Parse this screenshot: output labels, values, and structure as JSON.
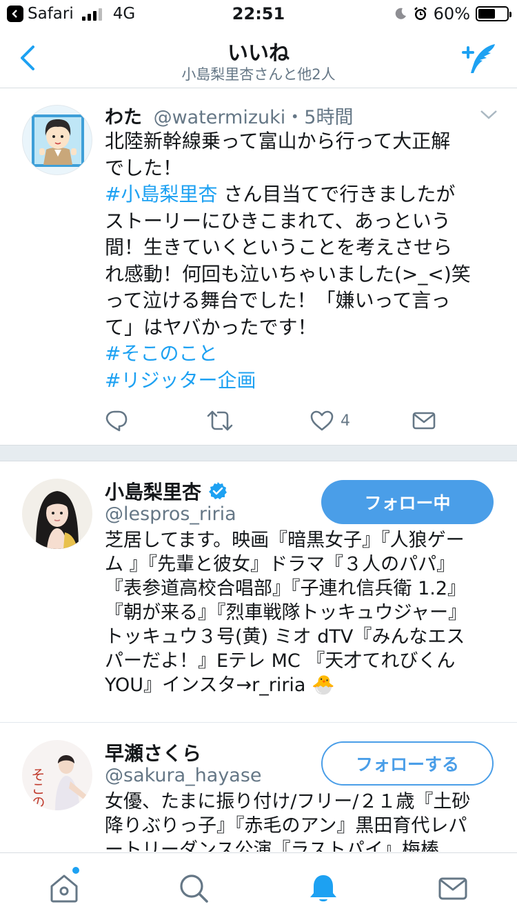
{
  "status_bar": {
    "app": "Safari",
    "network": "4G",
    "time": "22:51",
    "battery": "60%",
    "battery_level": 0.6
  },
  "nav": {
    "title": "いいね",
    "subtitle": "小島梨里杏さんと他2人"
  },
  "tweet": {
    "name": "わた",
    "handle": "@watermizuki",
    "time": "・5時間",
    "lines": [
      "北陸新幹線乗って富山から行って大正解",
      "でした！",
      "さん目当てで行きましたが",
      "ストーリーにひきこまれて、あっという",
      "間！生きていくということを考えさせら",
      "れ感動！何回も泣いちゃいました(>_<)笑",
      "って泣ける舞台でした！「嫌いって言っ",
      "て」はヤバかったです！"
    ],
    "mention_tag": "#小島梨里杏",
    "tags": [
      "#そこのこと",
      "#リジッター企画"
    ],
    "like_count": "4"
  },
  "users": [
    {
      "name": "小島梨里杏",
      "handle": "@lespros_riria",
      "button": "フォロー中",
      "bio": [
        "芝居してます。映画『暗黒女子』『人狼ゲー",
        "ム 』『先輩と彼女』ドラマ『３人のパパ』",
        "『表参道高校合唱部』『子連れ信兵衛 1.2』",
        "『朝が来る』『烈車戦隊トッキュウジャー』",
        "トッキュウ３号(黄) ミオ dTV『みんなエス",
        "パーだよ！』Eテレ MC 『天才てれびくん",
        "YOU』インスタ→r_riria 🐣"
      ]
    },
    {
      "name": "早瀬さくら",
      "handle": "@sakura_hayase",
      "button": "フォローする",
      "bio": [
        "女優、たまに振り付け/フリー/２１歳『土砂",
        "降りぶりっ子』『赤毛のアン』黒田育代レパ",
        "ートリーダンス公演『ラストパイ』梅棒"
      ],
      "avatar_text": "そこのこと"
    }
  ],
  "colors": {
    "accent": "#1da1f2",
    "button": "#4a9ee8",
    "secondary_text": "#657786",
    "divider": "#e6ecf0"
  },
  "tabs": [
    "home-icon",
    "search-icon",
    "notifications-icon",
    "messages-icon"
  ]
}
